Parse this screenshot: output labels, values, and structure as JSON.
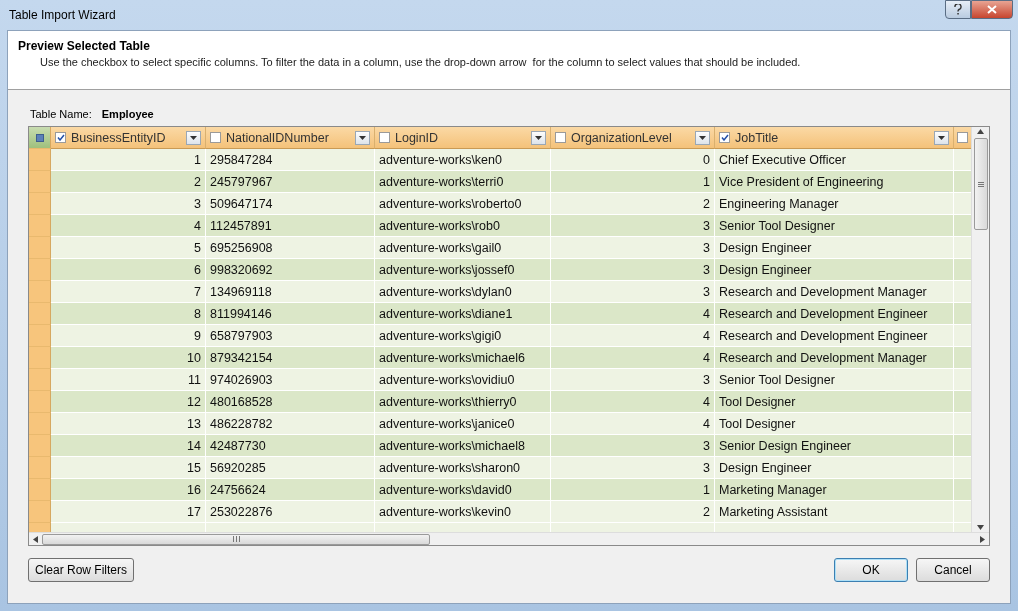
{
  "window": {
    "title": "Table Import Wizard"
  },
  "header": {
    "title": "Preview Selected Table",
    "description": "Use the checkbox to select specific columns. To filter the data in a column, use the drop-down arrow  for the column to select values that should be included."
  },
  "table_name": {
    "label": "Table Name:",
    "value": "Employee"
  },
  "columns": [
    {
      "label": "BusinessEntityID",
      "checked": true,
      "kind": "number"
    },
    {
      "label": "NationalIDNumber",
      "checked": false,
      "kind": "text"
    },
    {
      "label": "LoginID",
      "checked": false,
      "kind": "text"
    },
    {
      "label": "OrganizationLevel",
      "checked": false,
      "kind": "number"
    },
    {
      "label": "JobTitle",
      "checked": true,
      "kind": "text"
    }
  ],
  "extra_column": {
    "checked": false
  },
  "rows": [
    [
      "1",
      "295847284",
      "adventure-works\\ken0",
      "0",
      "Chief Executive Officer"
    ],
    [
      "2",
      "245797967",
      "adventure-works\\terri0",
      "1",
      "Vice President of Engineering"
    ],
    [
      "3",
      "509647174",
      "adventure-works\\roberto0",
      "2",
      "Engineering Manager"
    ],
    [
      "4",
      "112457891",
      "adventure-works\\rob0",
      "3",
      "Senior Tool Designer"
    ],
    [
      "5",
      "695256908",
      "adventure-works\\gail0",
      "3",
      "Design Engineer"
    ],
    [
      "6",
      "998320692",
      "adventure-works\\jossef0",
      "3",
      "Design Engineer"
    ],
    [
      "7",
      "134969118",
      "adventure-works\\dylan0",
      "3",
      "Research and Development Manager"
    ],
    [
      "8",
      "811994146",
      "adventure-works\\diane1",
      "4",
      "Research and Development Engineer"
    ],
    [
      "9",
      "658797903",
      "adventure-works\\gigi0",
      "4",
      "Research and Development Engineer"
    ],
    [
      "10",
      "879342154",
      "adventure-works\\michael6",
      "4",
      "Research and Development Manager"
    ],
    [
      "11",
      "974026903",
      "adventure-works\\ovidiu0",
      "3",
      "Senior Tool Designer"
    ],
    [
      "12",
      "480168528",
      "adventure-works\\thierry0",
      "4",
      "Tool Designer"
    ],
    [
      "13",
      "486228782",
      "adventure-works\\janice0",
      "4",
      "Tool Designer"
    ],
    [
      "14",
      "42487730",
      "adventure-works\\michael8",
      "3",
      "Senior Design Engineer"
    ],
    [
      "15",
      "56920285",
      "adventure-works\\sharon0",
      "3",
      "Design Engineer"
    ],
    [
      "16",
      "24756624",
      "adventure-works\\david0",
      "1",
      "Marketing Manager"
    ],
    [
      "17",
      "253022876",
      "adventure-works\\kevin0",
      "2",
      "Marketing Assistant"
    ]
  ],
  "buttons": {
    "clear": "Clear Row Filters",
    "ok": "OK",
    "cancel": "Cancel"
  }
}
